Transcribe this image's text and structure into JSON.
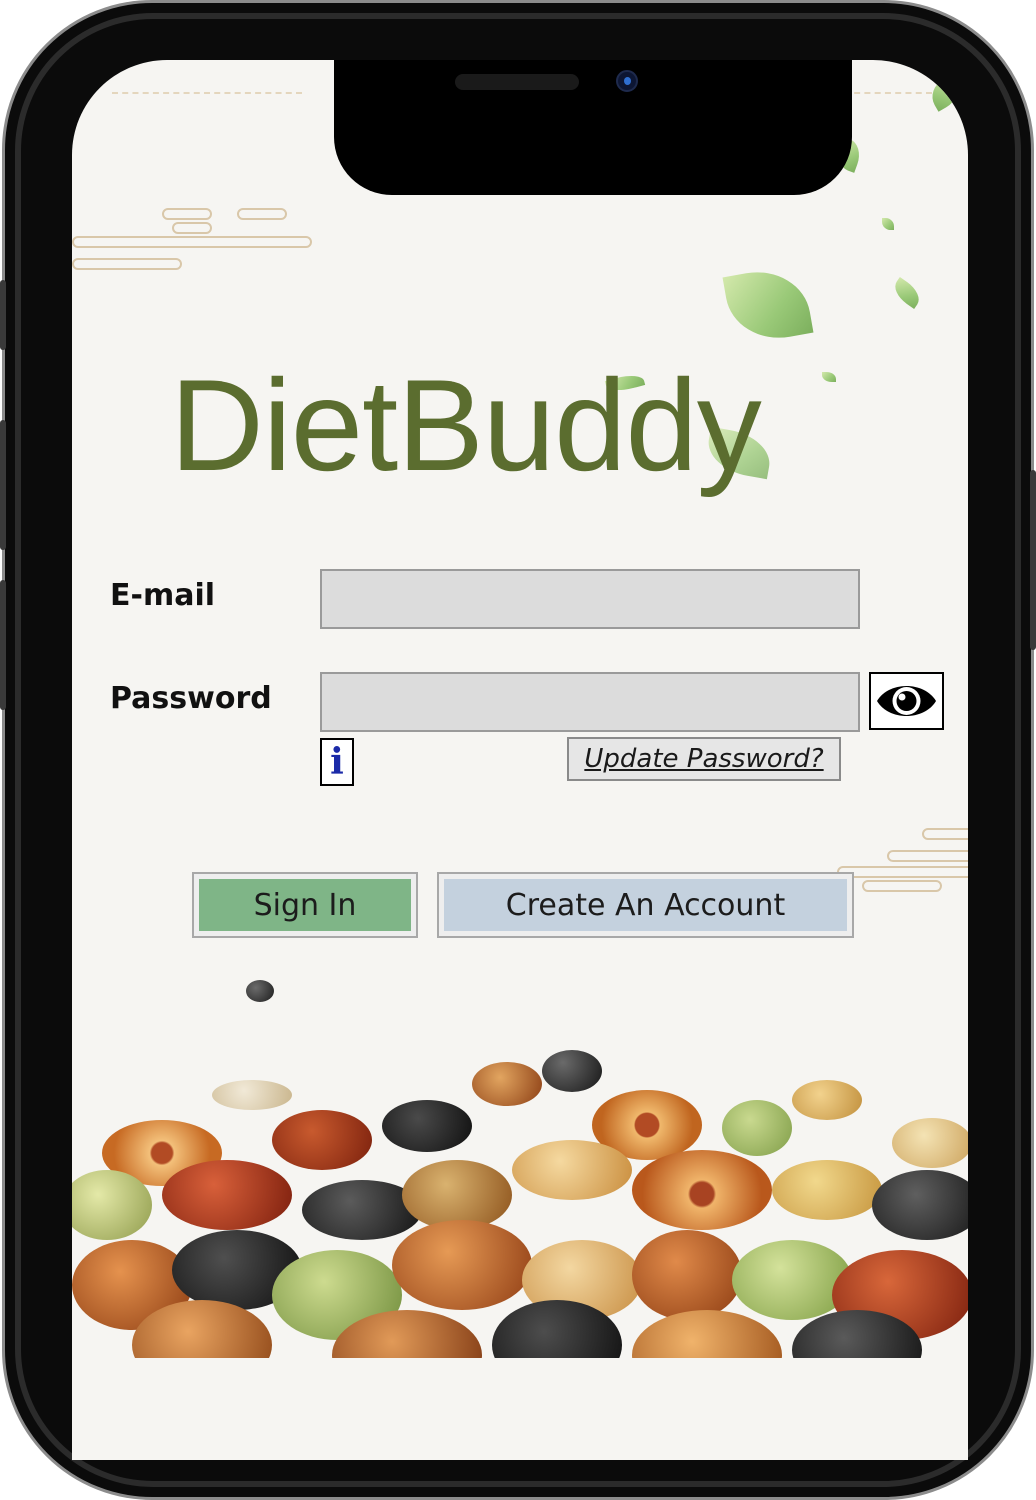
{
  "app": {
    "title": "DietBuddy"
  },
  "login_form": {
    "email_label": "E-mail",
    "email_value": "",
    "password_label": "Password",
    "password_value": "",
    "show_password_icon": "eye-icon",
    "info_icon": "info-icon",
    "info_glyph": "i",
    "update_password_link": "Update Password?"
  },
  "actions": {
    "sign_in_label": "Sign In",
    "create_account_label": "Create An Account"
  },
  "colors": {
    "title_text": "#5b6d2f",
    "sign_in_button": "#7fb587",
    "create_account_button": "#c4d1de",
    "input_background": "#dcdcdc",
    "screen_background": "#f6f5f2"
  },
  "decorations": {
    "top_illustration": "falling-green-leaves",
    "bottom_illustration": "mixed-nuts-and-dried-fruit"
  }
}
